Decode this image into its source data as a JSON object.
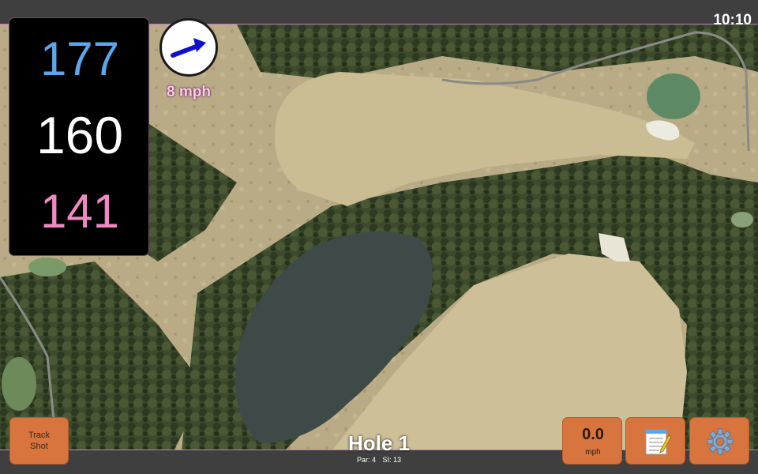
{
  "status": {
    "time": "10:10"
  },
  "yardages": {
    "back": "177",
    "middle": "160",
    "front": "141"
  },
  "wind": {
    "speed": "8 mph",
    "direction_icon": "wind-arrow-icon",
    "arrow_color": "#1010d0"
  },
  "hole": {
    "title": "Hole 1",
    "par": "Par: 4",
    "si": "SI: 13"
  },
  "buttons": {
    "track_shot_line1": "Track",
    "track_shot_line2": "Shot",
    "speed_value": "0.0",
    "speed_unit": "mph",
    "notes_icon": "notepad-icon",
    "settings_icon": "gear-icon"
  },
  "colors": {
    "back_yardage": "#5aa7ee",
    "middle_yardage": "#ffffff",
    "front_yardage": "#f088c4",
    "button_bg": "#d8753e"
  }
}
